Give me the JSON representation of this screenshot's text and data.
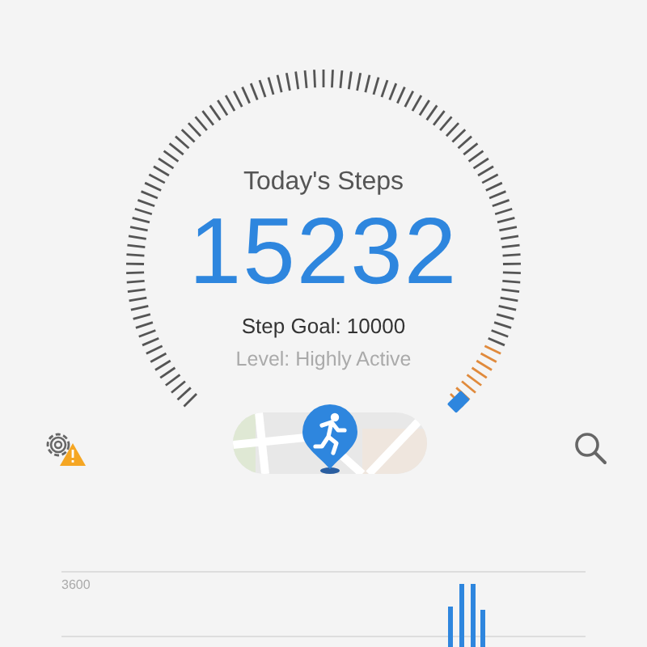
{
  "summary": {
    "title": "Today's Steps",
    "steps": "15232",
    "goal": "Step Goal: 10000",
    "activity_level": "Level: Highly Active"
  },
  "toolbar": {
    "settings_warning": true
  },
  "chart": {
    "axis_label": "3600"
  }
}
